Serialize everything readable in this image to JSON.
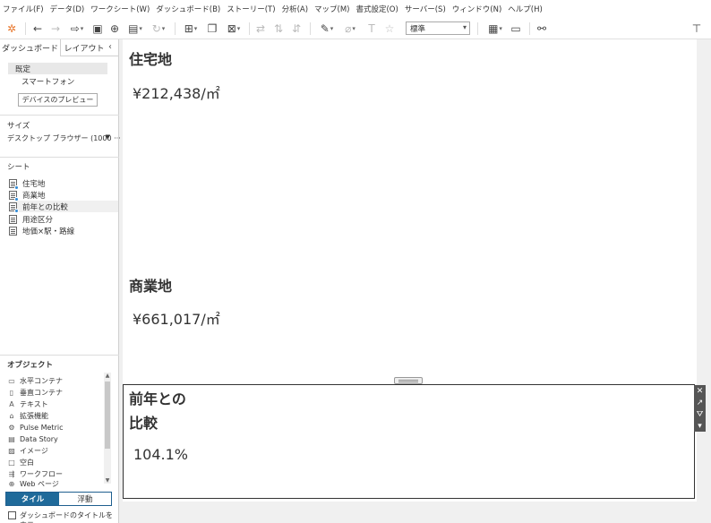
{
  "menu": [
    "ファイル(F)",
    "データ(D)",
    "ワークシート(W)",
    "ダッシュボード(B)",
    "ストーリー(T)",
    "分析(A)",
    "マップ(M)",
    "書式設定(O)",
    "サーバー(S)",
    "ウィンドウ(N)",
    "ヘルプ(H)"
  ],
  "toolbar": {
    "fit_value": "標準"
  },
  "sidebar": {
    "tabs": {
      "dashboard": "ダッシュボード",
      "layout": "レイアウト"
    },
    "device": {
      "default": "既定",
      "phone": "スマートフォン",
      "preview_button": "デバイスのプレビュー"
    },
    "size": {
      "title": "サイズ",
      "value": "デスクトップ ブラウザー (1000 ···"
    },
    "sheets": {
      "title": "シート",
      "items": [
        "住宅地",
        "商業地",
        "前年との比較",
        "用途区分",
        "地価×駅・路線"
      ]
    },
    "objects": {
      "title": "オブジェクト",
      "items": [
        "水平コンテナ",
        "垂直コンテナ",
        "テキスト",
        "拡張機能",
        "Pulse Metric",
        "Data Story",
        "イメージ",
        "空白",
        "ワークフロー",
        "Web ページ"
      ]
    },
    "tile_label": "タイル",
    "float_label": "浮動",
    "show_title_label": "ダッシュボードのタイトルを表示"
  },
  "dashboard": {
    "residential": {
      "title": "住宅地",
      "value": "¥212,438/㎡"
    },
    "commercial": {
      "title": "商業地",
      "value": "¥661,017/㎡"
    },
    "yoy": {
      "title_line1": "前年との",
      "title_line2": "比較",
      "value": "104.1%"
    }
  }
}
